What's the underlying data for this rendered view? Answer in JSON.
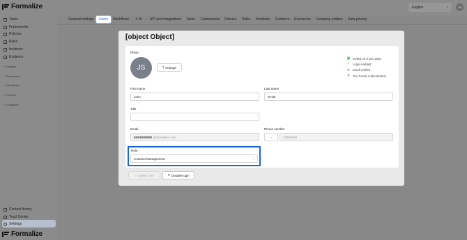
{
  "app": {
    "name": "Formalize"
  },
  "sidebar": {
    "items": [
      {
        "label": "Tasks",
        "icon": "tasks-icon"
      },
      {
        "label": "Frameworks",
        "icon": "frameworks-icon"
      },
      {
        "label": "Policies",
        "icon": "policies-icon"
      },
      {
        "label": "Risks",
        "icon": "risks-icon"
      },
      {
        "label": "Incidents",
        "icon": "incidents-icon"
      },
      {
        "label": "Evidence",
        "icon": "evidence-icon"
      }
    ],
    "sections": [
      "Insights",
      "Resources",
      "Workflows",
      "Privacy",
      "Guidance"
    ],
    "bottom_items": [
      {
        "label": "Content library",
        "icon": "library-icon"
      },
      {
        "label": "Trust Center",
        "icon": "trust-center-icon"
      },
      {
        "label": "Settings",
        "icon": "settings-icon"
      }
    ]
  },
  "topbar": {
    "language": "English",
    "user_initials": "CR"
  },
  "tabs": [
    "General settings",
    "Users",
    "Workflows",
    "AI",
    "API and integrations",
    "Tasks",
    "Frameworks",
    "Policies",
    "Risks",
    "Incidents",
    "Evidence",
    "Resources",
    "Company entities",
    "Data privacy"
  ],
  "modal": {
    "title": {
      "label": "Title",
      "value": ""
    },
    "photo_label": "Photo",
    "avatar_initials": "JS",
    "change_label": "Change",
    "status": [
      {
        "text": "Invited on 8 Dec 2025",
        "icon": "calendar-icon",
        "color": "#2e9e5b"
      },
      {
        "text": "Login enabled",
        "icon": "check-icon",
        "color": "#2e9e5b"
      },
      {
        "text": "Email verified",
        "icon": "x-icon",
        "color": "#333333"
      },
      {
        "text": "Two Factor Authentication",
        "icon": "x-icon",
        "color": "#333333"
      }
    ],
    "first_name": {
      "label": "First name",
      "value": "John"
    },
    "last_name": {
      "label": "Last name",
      "value": "Smith"
    },
    "email": {
      "label": "Email",
      "value": "@formalize.com"
    },
    "phone": {
      "label": "Phone number",
      "placeholder": "12345678"
    },
    "role": {
      "label": "Role",
      "value": "Contract Management"
    },
    "delete_label": "Delete user",
    "disable_label": "Disable login"
  },
  "colors": {
    "highlight": "#1565d8",
    "active_tab": "#1f6bd6"
  }
}
